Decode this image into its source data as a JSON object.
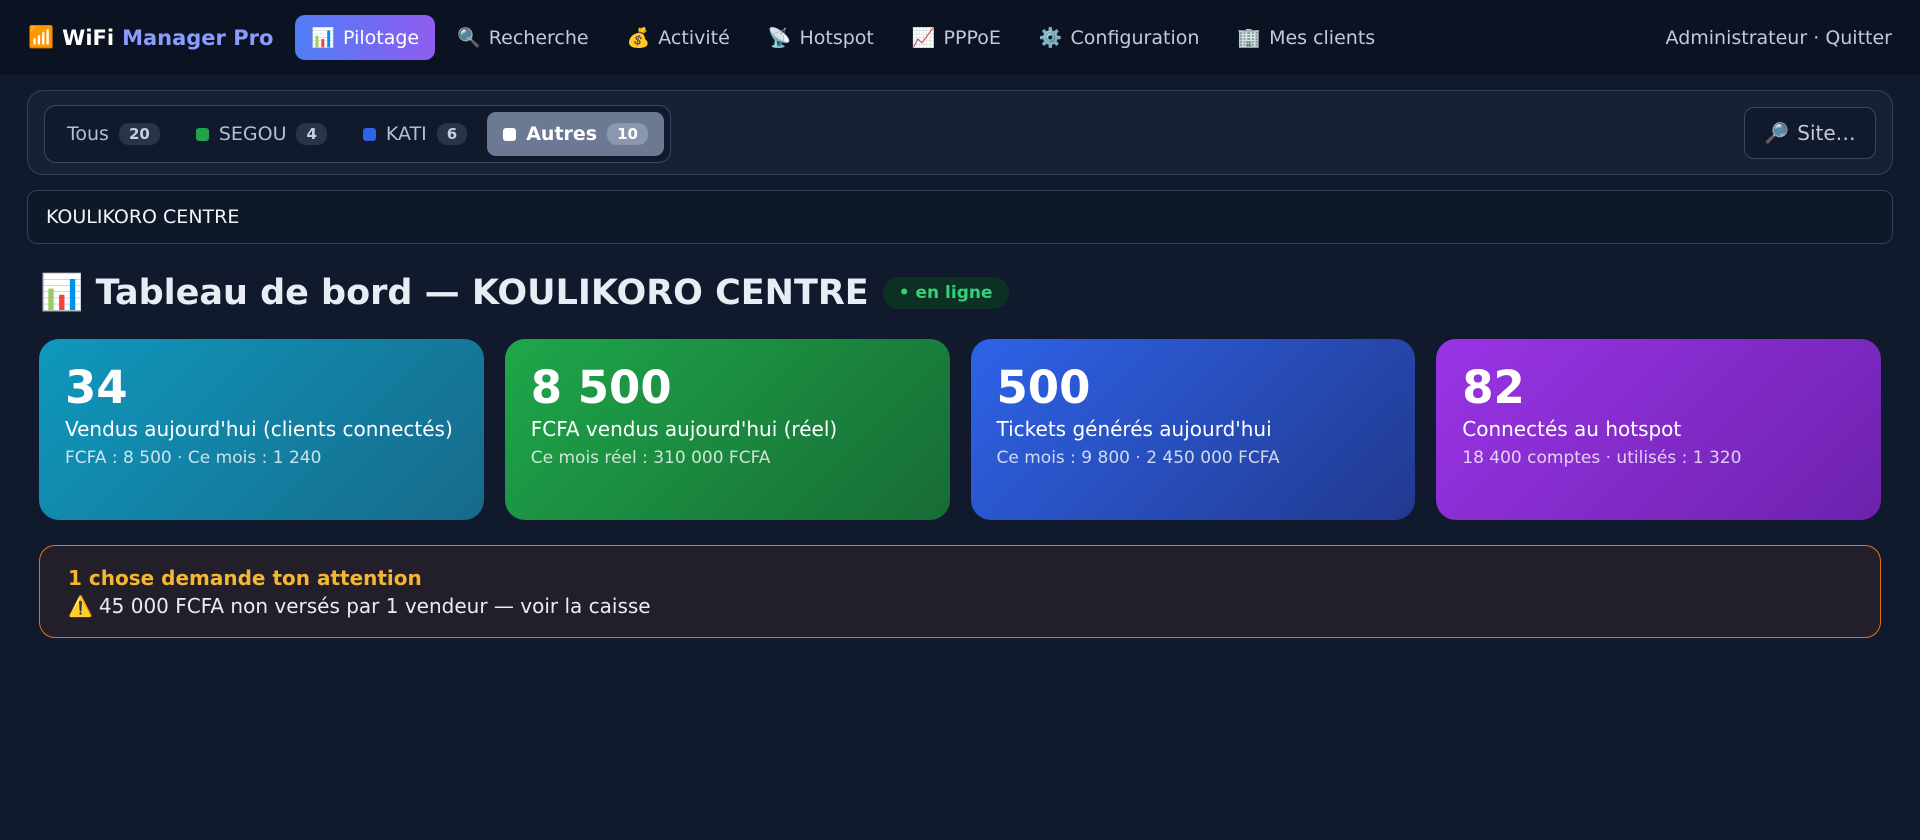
{
  "header": {
    "brand_icon": "📶",
    "brand_part1": "WiFi",
    "brand_part2": "Manager Pro",
    "nav": [
      {
        "icon": "📊",
        "label": "Pilotage",
        "active": true
      },
      {
        "icon": "🔍",
        "label": "Recherche"
      },
      {
        "icon": "💰",
        "label": "Activité"
      },
      {
        "icon": "📡",
        "label": "Hotspot"
      },
      {
        "icon": "📈",
        "label": "PPPoE"
      },
      {
        "icon": "⚙️",
        "label": "Configuration"
      },
      {
        "icon": "🏢",
        "label": "Mes clients"
      }
    ],
    "user": "Administrateur",
    "separator": "·",
    "logout": "Quitter"
  },
  "filters": {
    "segments": [
      {
        "label": "Tous",
        "count": "20"
      },
      {
        "label": "SEGOU",
        "count": "4",
        "color": "#22a34a"
      },
      {
        "label": "KATI",
        "count": "6",
        "color": "#2e63e8"
      },
      {
        "label": "Autres",
        "count": "10",
        "color": "#ffffff",
        "active": true
      }
    ],
    "site_button_icon": "🔎",
    "site_button_label": "Site…"
  },
  "site_field": {
    "value": "KOULIKORO CENTRE"
  },
  "dashboard": {
    "icon": "📊",
    "title": "Tableau de bord — KOULIKORO CENTRE",
    "status": "• en ligne",
    "status_color": "#34d17a"
  },
  "cards": [
    {
      "value": "34",
      "label": "Vendus aujourd'hui (clients connectés)",
      "sub": "FCFA : 8 500 · Ce mois : 1 240"
    },
    {
      "value": "8 500",
      "label": "FCFA vendus aujourd'hui (réel)",
      "sub": "Ce mois réel : 310 000 FCFA"
    },
    {
      "value": "500",
      "label": "Tickets générés aujourd'hui",
      "sub": "Ce mois : 9 800 · 2 450 000 FCFA"
    },
    {
      "value": "82",
      "label": "Connectés au hotspot",
      "sub": "18 400 comptes · utilisés : 1 320"
    }
  ],
  "alert": {
    "title": "1 chose demande ton attention",
    "icon": "⚠️",
    "text": "45 000 FCFA non versés par 1 vendeur — voir la caisse",
    "border_color": "#d9761c"
  }
}
